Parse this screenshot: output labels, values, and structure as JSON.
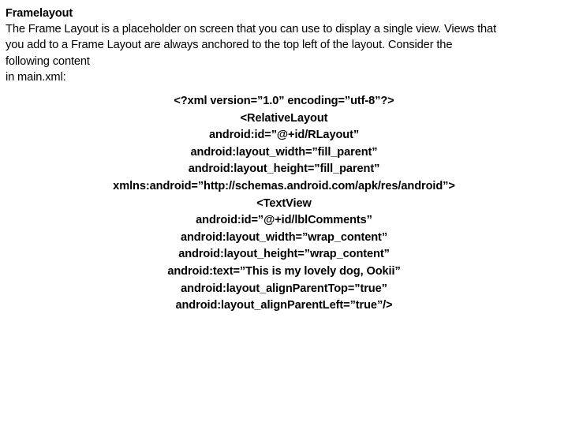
{
  "document": {
    "title": "Framelayout",
    "background_color": "#ffffff",
    "text_color": "#000000",
    "body_lines": [
      "The Frame Layout is a placeholder on screen that you can use to display a single view. Views that",
      "you add to a Frame Layout are always anchored to the top left of the layout. Consider the",
      "following content",
      "in main.xml:"
    ],
    "code_listing": {
      "language": "xml",
      "alignment": "center",
      "weight": "bold",
      "lines": [
        "<?xml version=”1.0” encoding=”utf-8”?>",
        "<RelativeLayout",
        "android:id=”@+id/RLayout”",
        "android:layout_width=”fill_parent”",
        "android:layout_height=”fill_parent”",
        "xmlns:android=”http://schemas.android.com/apk/res/android”>",
        "<TextView",
        "android:id=”@+id/lblComments”",
        "android:layout_width=”wrap_content”",
        "android:layout_height=”wrap_content”",
        "android:text=”This is my lovely dog, Ookii”",
        "android:layout_alignParentTop=”true”",
        "android:layout_alignParentLeft=”true”/>"
      ]
    }
  }
}
